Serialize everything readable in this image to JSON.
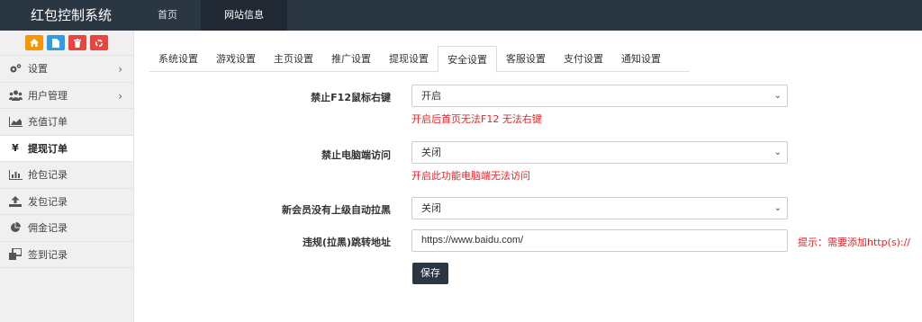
{
  "app": {
    "title": "红包控制系统"
  },
  "topnav": [
    {
      "label": "首页",
      "active": false
    },
    {
      "label": "网站信息",
      "active": true
    }
  ],
  "quick_buttons": [
    {
      "icon": "home-icon",
      "color": "#f89406"
    },
    {
      "icon": "document-icon",
      "color": "#2d9fe0"
    },
    {
      "icon": "trash-icon",
      "color": "#e9443d"
    },
    {
      "icon": "recycle-icon",
      "color": "#e9443d"
    }
  ],
  "sidebar": {
    "items": [
      {
        "label": "设置",
        "icon": "gears-icon",
        "has_arrow": true,
        "active": false
      },
      {
        "label": "用户管理",
        "icon": "users-icon",
        "has_arrow": true,
        "active": false
      },
      {
        "label": "充值订单",
        "icon": "area-chart-icon",
        "has_arrow": false,
        "active": false
      },
      {
        "label": "提现订单",
        "icon": "yen-icon",
        "has_arrow": false,
        "active": true
      },
      {
        "label": "抢包记录",
        "icon": "bar-chart-icon",
        "has_arrow": false,
        "active": false
      },
      {
        "label": "发包记录",
        "icon": "upload-icon",
        "has_arrow": false,
        "active": false
      },
      {
        "label": "佣金记录",
        "icon": "pie-chart-icon",
        "has_arrow": false,
        "active": false
      },
      {
        "label": "签到记录",
        "icon": "clone-icon",
        "has_arrow": false,
        "active": false
      }
    ]
  },
  "tabs": [
    {
      "label": "系统设置",
      "active": false
    },
    {
      "label": "游戏设置",
      "active": false
    },
    {
      "label": "主页设置",
      "active": false
    },
    {
      "label": "推广设置",
      "active": false
    },
    {
      "label": "提现设置",
      "active": false
    },
    {
      "label": "安全设置",
      "active": true
    },
    {
      "label": "客服设置",
      "active": false
    },
    {
      "label": "支付设置",
      "active": false
    },
    {
      "label": "通知设置",
      "active": false
    }
  ],
  "form": {
    "f12": {
      "label": "禁止F12鼠标右键",
      "value": "开启",
      "hint": "开启后首页无法F12 无法右键"
    },
    "pc": {
      "label": "禁止电脑端访问",
      "value": "关闭",
      "hint": "开启此功能电脑端无法访问"
    },
    "auto_block": {
      "label": "新会员没有上级自动拉黑",
      "value": "关闭"
    },
    "redirect": {
      "label": "违规(拉黑)跳转地址",
      "value": "https://www.baidu.com/",
      "side_hint": "提示：需要添加http(s)://"
    },
    "save_label": "保存"
  },
  "colors": {
    "topbar": "#2b3643",
    "hint_red": "#e0262b",
    "sidebar_bg": "#f0f0f0"
  }
}
